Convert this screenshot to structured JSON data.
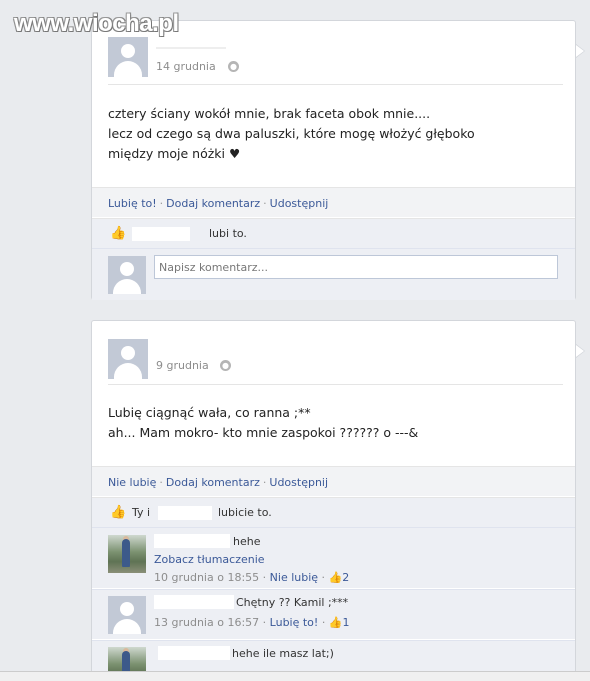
{
  "watermark": "www.wiocha.pl",
  "posts": [
    {
      "date": "14 grudnia",
      "text_lines": [
        "cztery ściany wokół mnie, brak faceta obok mnie....",
        "lecz od czego są dwa paluszki, które mogę włożyć głęboko",
        "między moje nóżki ♥"
      ],
      "actions": {
        "like": "Lubię to!",
        "comment": "Dodaj komentarz",
        "share": "Udostępnij"
      },
      "likes_text": "lubi to.",
      "comment_placeholder": "Napisz komentarz..."
    },
    {
      "date": "9 grudnia",
      "text_lines": [
        "Lubię ciągnąć wała, co ranna ;**",
        "ah... Mam mokro- kto mnie zaspokoi ?????? o ---&"
      ],
      "actions": {
        "like": "Nie lubię",
        "comment": "Dodaj komentarz",
        "share": "Udostępnij"
      },
      "likes_prefix": "Ty i",
      "likes_text": "lubicie to.",
      "comments": [
        {
          "text": "hehe",
          "translate": "Zobacz tłumaczenie",
          "time": "10 grudnia o 18:55",
          "action": "Nie lubię",
          "likes": "2"
        },
        {
          "text": "Chętny ?? Kamil ;***",
          "time": "13 grudnia o 16:57",
          "action": "Lubię to!",
          "likes": "1"
        },
        {
          "text": "hehe ile masz lat;)"
        }
      ]
    }
  ],
  "icons": {
    "globe": "globe-icon",
    "thumb": "thumbs-up-icon"
  }
}
